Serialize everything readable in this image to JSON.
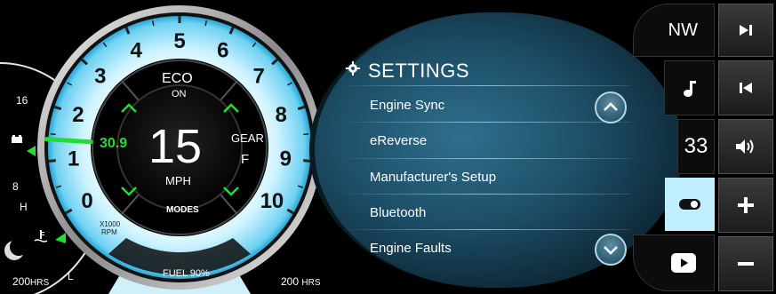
{
  "dial": {
    "numbers": [
      "0",
      "1",
      "2",
      "3",
      "4",
      "5",
      "6",
      "7",
      "8",
      "9",
      "10"
    ],
    "unit_top": "X1000",
    "unit_bottom": "RPM",
    "eco_label": "ECO",
    "eco_state": "ON",
    "gear_label": "GEAR",
    "gear_value": "F",
    "speed_value": "15",
    "speed_unit": "MPH",
    "secondary_value": "30.9",
    "modes_label": "MODES",
    "fuel_label": "FUEL 90%",
    "left_hours": "200",
    "right_hours": "200",
    "hours_unit": "HRS",
    "needle_rpm": 1.4
  },
  "side_gauge": {
    "top_value": "16",
    "mid_value": "8",
    "high_label": "H",
    "low_label": "L"
  },
  "settings": {
    "title": "SETTINGS",
    "items": [
      {
        "label": "Engine Sync"
      },
      {
        "label": "eReverse"
      },
      {
        "label": "Manufacturer's Setup"
      },
      {
        "label": "Bluetooth"
      },
      {
        "label": "Engine Faults"
      }
    ]
  },
  "right_panel": {
    "heading": "NW",
    "channel": "33"
  },
  "colors": {
    "accent_green": "#22dd33",
    "glow": "#bfefff",
    "panel": "#1d4f68"
  }
}
